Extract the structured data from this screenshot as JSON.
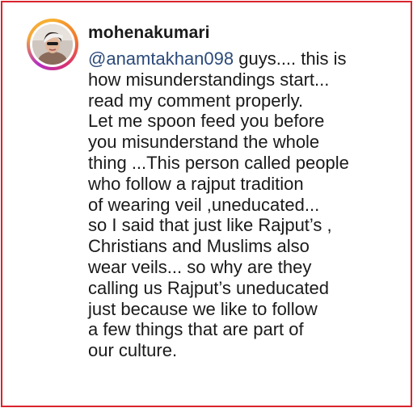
{
  "comment": {
    "username": "mohenakumari",
    "avatar_icon": "profile-photo",
    "mention": "@anamtakhan098",
    "first_line_rest": " guys.... this is",
    "lines": [
      "how misunderstandings start...",
      "read my comment properly.",
      "Let me spoon feed you before",
      "you misunderstand the whole",
      "thing ...This person called people",
      "who follow a rajput tradition",
      "of wearing veil ,uneducated...",
      "so I said that just like Rajput’s ,",
      "Christians and Muslims also",
      "wear veils... so why are they",
      "calling us Rajput’s uneducated",
      "just because we like to follow",
      "a few things that are part of",
      "our culture."
    ]
  },
  "colors": {
    "border": "#d9232e",
    "text": "#1a1a1a",
    "mention": "#2c4a7a",
    "story_ring": [
      "#f6b032",
      "#d9316f",
      "#b42ec0"
    ]
  }
}
